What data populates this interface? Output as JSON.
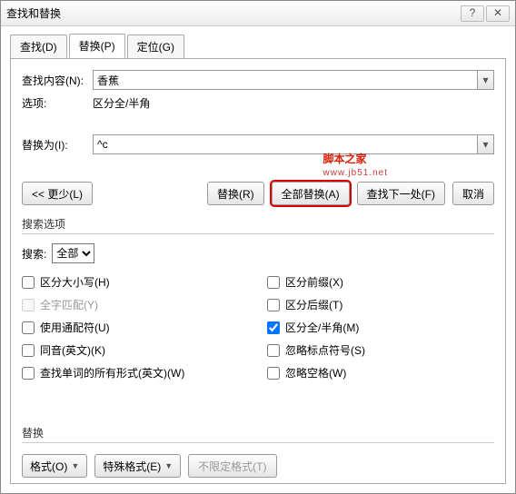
{
  "title": "查找和替换",
  "tabs": {
    "find": "查找(D)",
    "replace": "替换(P)",
    "goto": "定位(G)"
  },
  "fields": {
    "find_label": "查找内容(N):",
    "find_value": "香蕉",
    "opt_label": "选项:",
    "opt_value": "区分全/半角",
    "replace_label": "替换为(I):",
    "replace_value": "^c"
  },
  "buttons": {
    "less": "<< 更少(L)",
    "replace": "替换(R)",
    "replace_all": "全部替换(A)",
    "find_next": "查找下一处(F)",
    "cancel": "取消"
  },
  "search_group": "搜索选项",
  "search_label": "搜索:",
  "search_scope": "全部",
  "checks_left": {
    "case": "区分大小写(H)",
    "whole": "全字匹配(Y)",
    "wildcard": "使用通配符(U)",
    "homonym": "同音(英文)(K)",
    "allforms": "查找单词的所有形式(英文)(W)"
  },
  "checks_right": {
    "prefix": "区分前缀(X)",
    "suffix": "区分后缀(T)",
    "fullhalf": "区分全/半角(M)",
    "punct": "忽略标点符号(S)",
    "space": "忽略空格(W)"
  },
  "replace_group": "替换",
  "format_btns": {
    "format": "格式(O)",
    "special": "特殊格式(E)",
    "noformat": "不限定格式(T)"
  },
  "watermark": {
    "main": "脚本之家",
    "sub": "www.jb51.net"
  }
}
